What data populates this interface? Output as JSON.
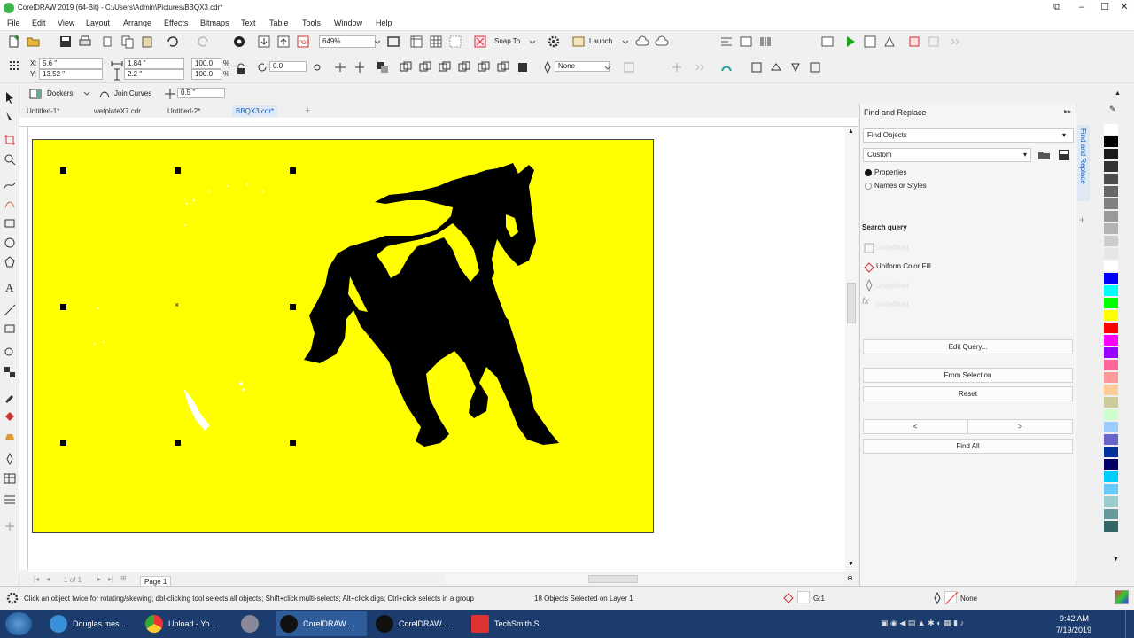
{
  "window": {
    "title": "CorelDRAW 2019 (64-Bit) - C:\\Users\\Admin\\Pictures\\BBQX3.cdr*"
  },
  "menu": [
    "File",
    "Edit",
    "View",
    "Layout",
    "Arrange",
    "Effects",
    "Bitmaps",
    "Text",
    "Table",
    "Tools",
    "Window",
    "Help"
  ],
  "standard_toolbar": {
    "zoom": "649%",
    "snap_to": "Snap To",
    "launch": "Launch"
  },
  "property_bar": {
    "x": "5.6 \"",
    "y": "13.52 \"",
    "w": "1.84 \"",
    "h": "2.2 \"",
    "scale_w": "100.0",
    "scale_h": "100.0",
    "percent": "%",
    "angle": "0.0",
    "outline": "None"
  },
  "secondary_bar": {
    "dockers": "Dockers",
    "join_curves": "Join Curves",
    "distance": "0.5 \""
  },
  "doc_tabs": [
    "Untitled-1*",
    "wetplateX7.cdr",
    "Untitled-2*",
    "BBQX3.cdr*"
  ],
  "docker": {
    "title": "Find and Replace",
    "vertical_tab": "Find and Replace",
    "find_select": "Find Objects",
    "custom_select": "Custom",
    "radio_properties": "Properties",
    "radio_names": "Names or Styles",
    "search_query_label": "Search query",
    "query_items": [
      "Undefined",
      "Uniform Color Fill",
      "Undefined",
      "Undefined"
    ],
    "edit_query": "Edit Query...",
    "from_selection": "From Selection",
    "reset": "Reset",
    "prev": "<",
    "next": ">",
    "find_all": "Find All"
  },
  "page_nav": {
    "page_count": "1 of 1",
    "page_tab": "Page 1"
  },
  "status": {
    "hint": "Click an object twice for rotating/skewing; dbl-clicking tool selects all objects; Shift+click multi-selects; Alt+click digs; Ctrl+click selects in a group",
    "selection": "18 Objects Selected on Layer 1",
    "fill": "G:1",
    "outline": "None"
  },
  "taskbar": {
    "apps": [
      "Douglas mes...",
      "Upload - Yo...",
      "CorelDRAW ...",
      "CorelDRAW ...",
      "TechSmith S..."
    ],
    "time": "9:42 AM",
    "date": "7/19/2019"
  },
  "palette": [
    "#ffffff",
    "#000000",
    "#1a1a1a",
    "#333333",
    "#4d4d4d",
    "#666666",
    "#808080",
    "#999999",
    "#b3b3b3",
    "#cccccc",
    "#e6e6e6",
    "#ffffff",
    "#0000ff",
    "#00ffff",
    "#00ff00",
    "#ffff00",
    "#ff0000",
    "#ff00ff",
    "#9900ff",
    "#ff6699",
    "#ff9999",
    "#ffcc99",
    "#cccc99",
    "#ccffcc",
    "#99ccff",
    "#6666cc",
    "#003399",
    "#000066",
    "#00ccff",
    "#66ccff",
    "#99cccc",
    "#669999",
    "#336666"
  ],
  "colors": {
    "page_fill": "#ffff00",
    "accent": "#1a5fb4",
    "taskbar": "#1d3c6e"
  }
}
